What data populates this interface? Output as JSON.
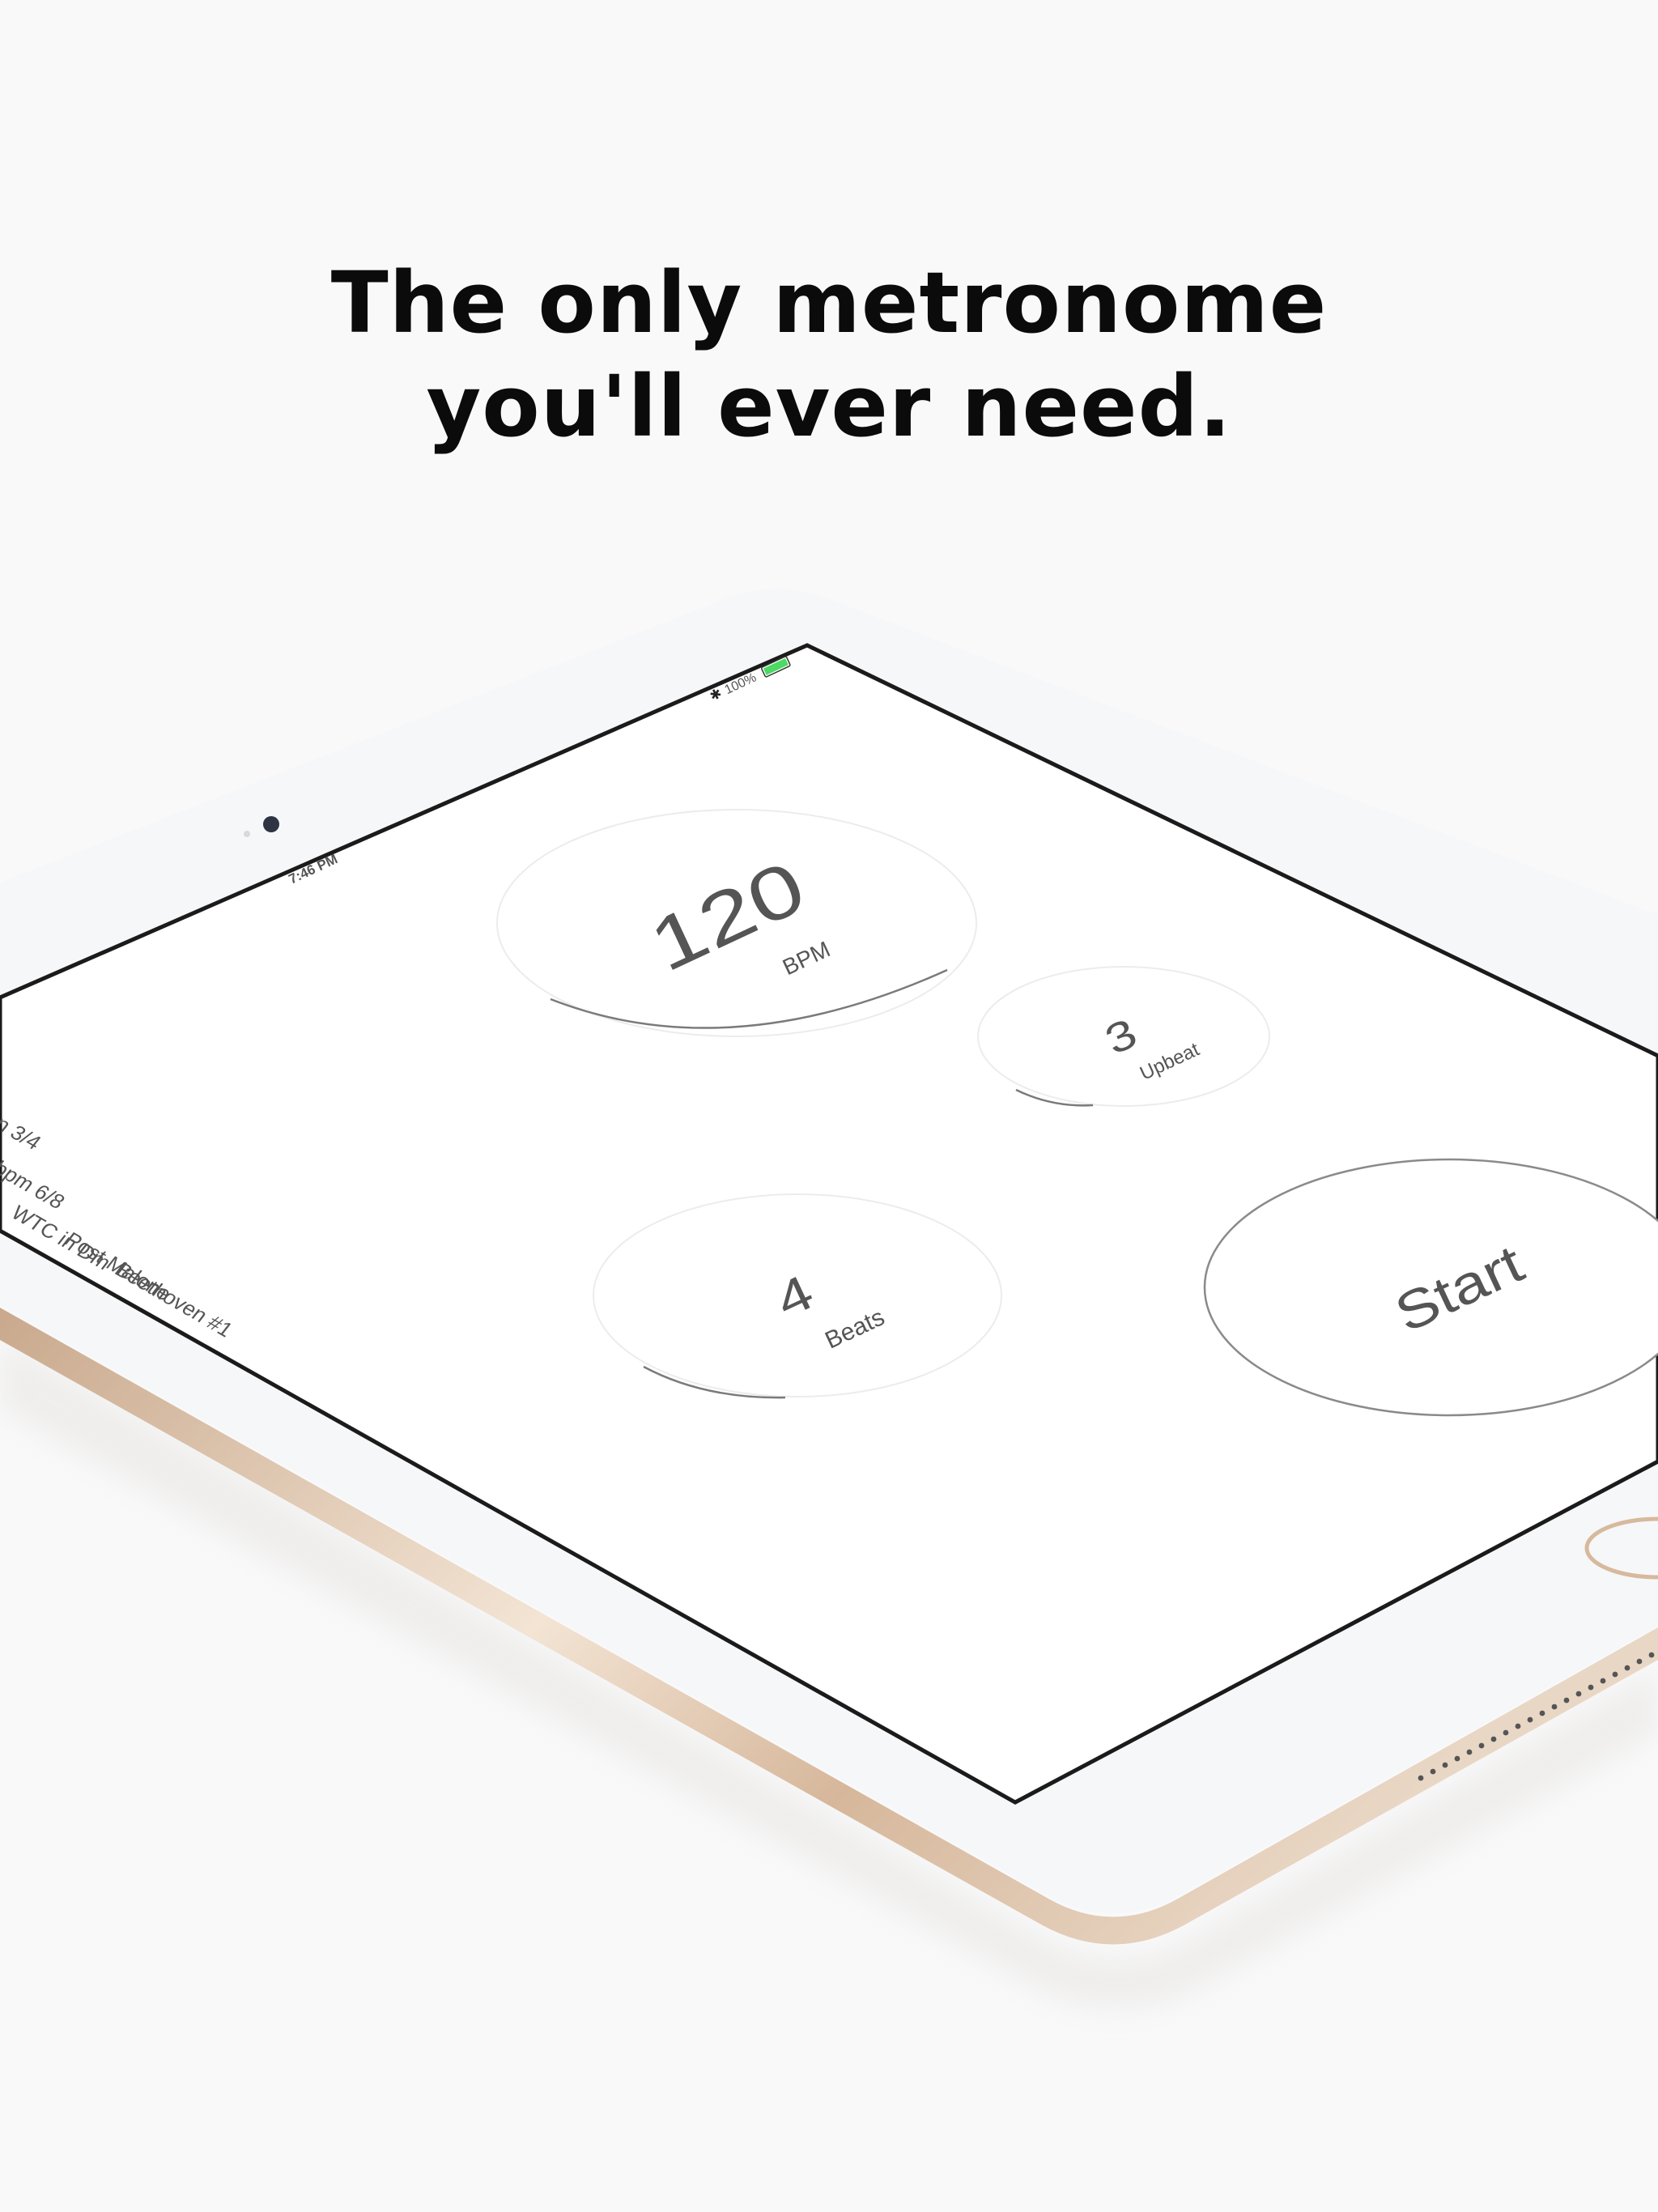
{
  "headline": {
    "line1": "The only metronome",
    "line2": "you'll ever need."
  },
  "status_bar": {
    "time": "7:46 PM",
    "battery": "100%",
    "bluetooth_icon": "bluetooth-icon",
    "battery_icon": "battery-icon"
  },
  "presets": [
    "n 3/4",
    "bpm 6/8",
    "WTC in Dm",
    "Post Malone",
    "Beethoven #1"
  ],
  "controls": {
    "tempo": {
      "value": "120",
      "label": "BPM"
    },
    "upbeat": {
      "value": "3",
      "label": "Upbeat"
    },
    "beats": {
      "value": "4",
      "label": "Beats"
    },
    "start_label": "Start"
  },
  "colors": {
    "background": "#f9f9fa",
    "bezel": "#f6f7f9",
    "screen": "#ffffff",
    "gold_edge": "#d9bfa6",
    "battery_green": "#4cd964"
  }
}
